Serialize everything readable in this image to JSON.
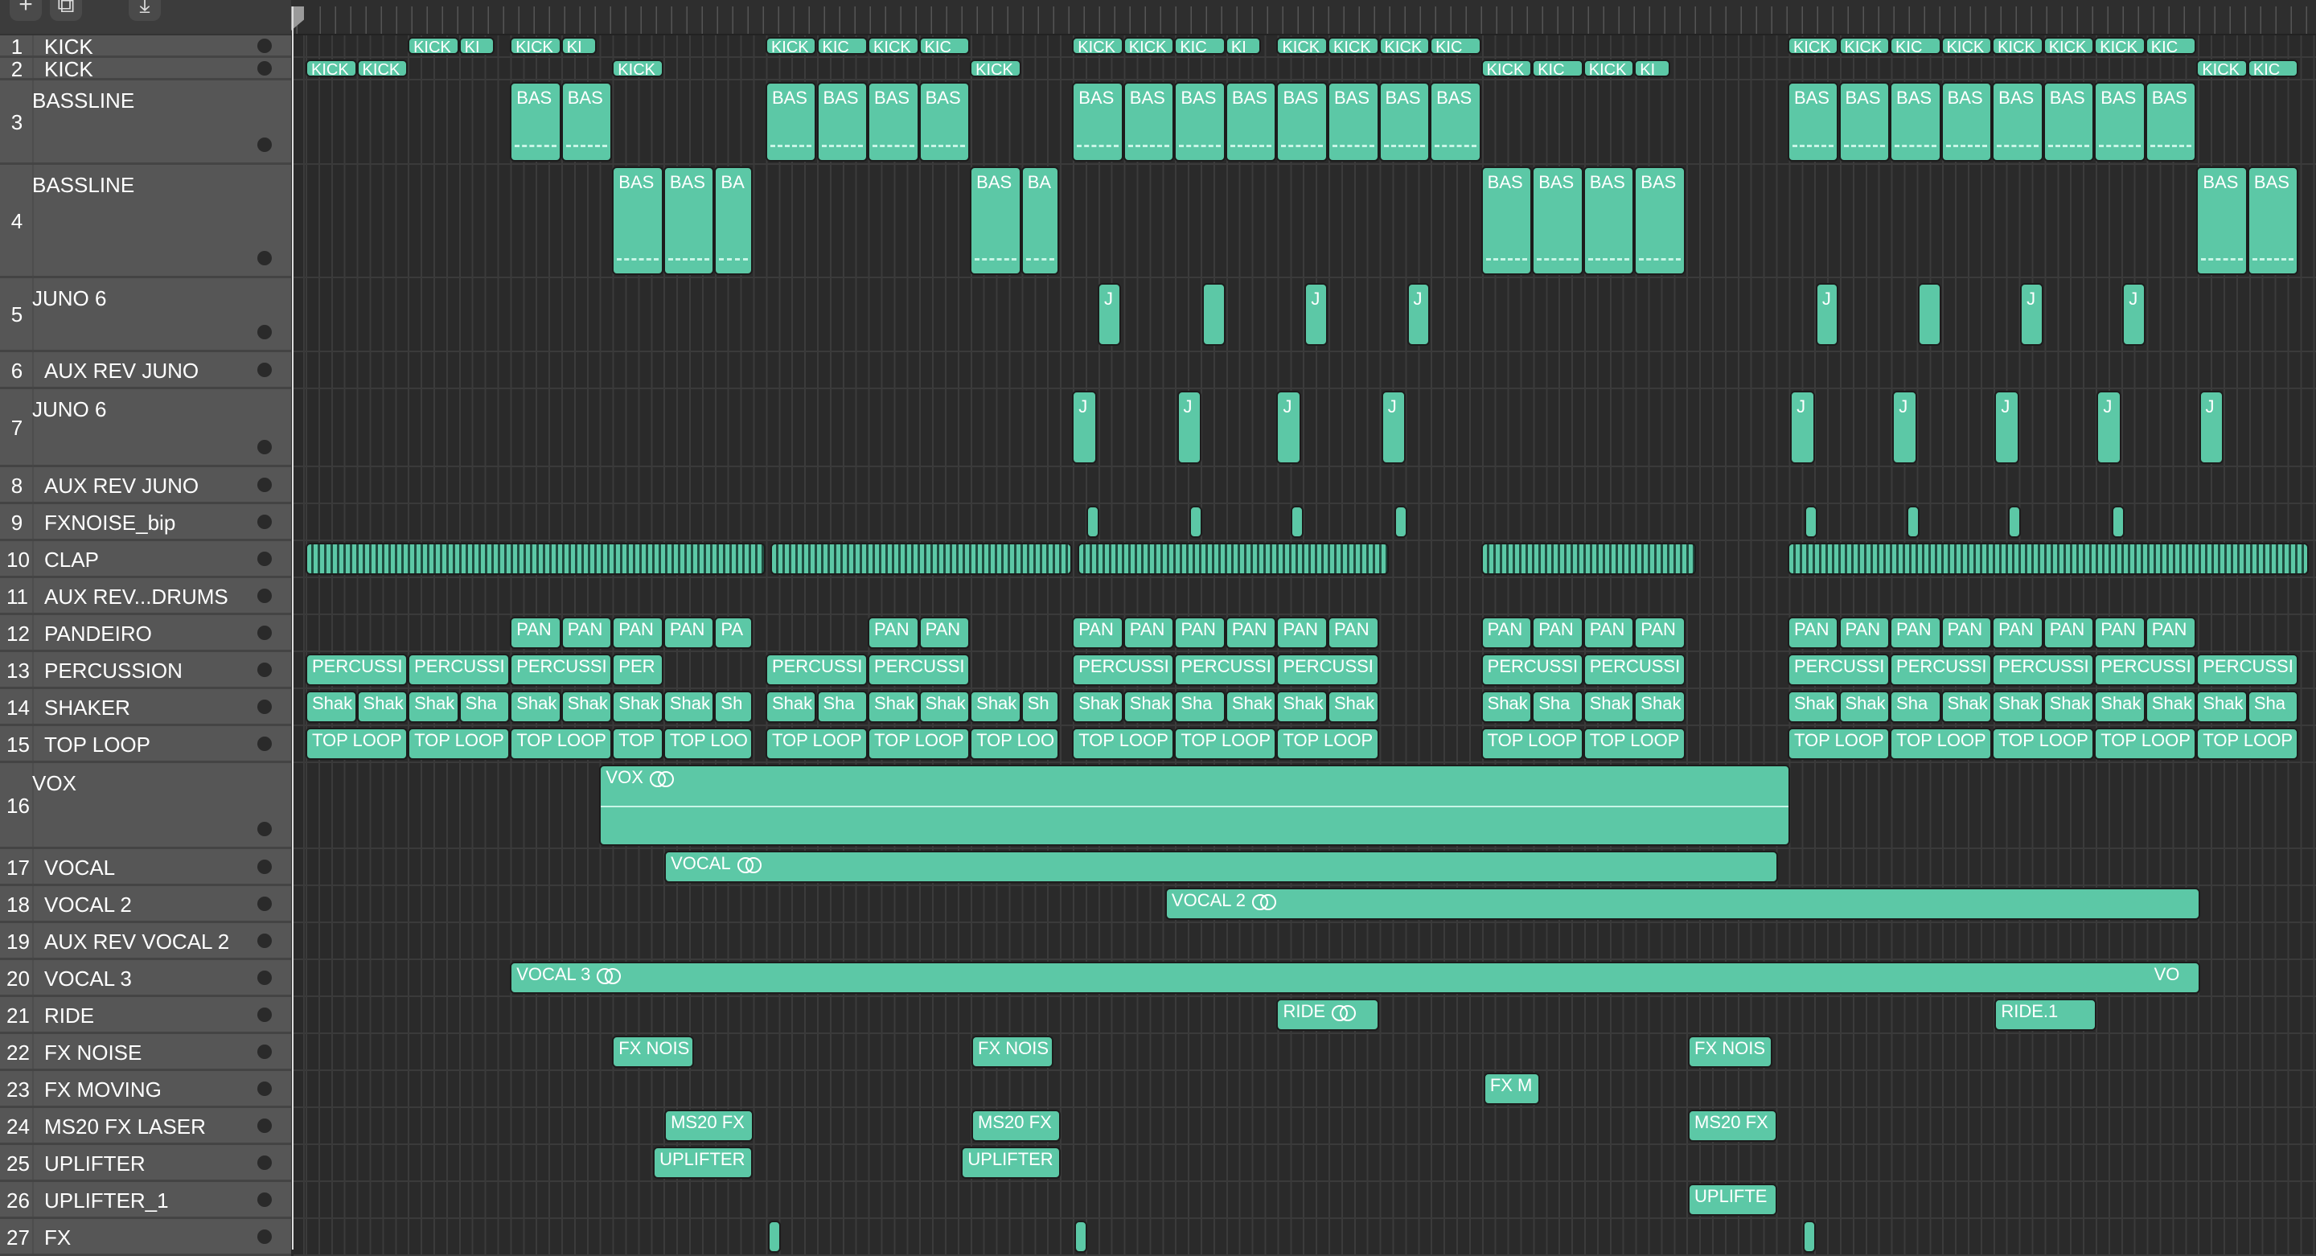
{
  "toolbar": {
    "add_icon": "+",
    "duplicate_icon": "⧉",
    "download_icon": "⤓"
  },
  "colors": {
    "region": "#5cc8a6",
    "header": "#565656",
    "lane": "#2a2a2a"
  },
  "tracks": [
    {
      "num": "1",
      "name": "KICK",
      "regions": [
        {
          "l": "KICK",
          "s": 2,
          "w": 1
        },
        {
          "l": "KI",
          "s": 3,
          "w": 0.7
        },
        {
          "l": "KICK",
          "s": 4,
          "w": 1
        },
        {
          "l": "KI",
          "s": 5,
          "w": 0.7
        },
        {
          "l": "KICK",
          "s": 9,
          "w": 1
        },
        {
          "l": "KIC",
          "s": 10,
          "w": 1
        },
        {
          "l": "KICK",
          "s": 11,
          "w": 1
        },
        {
          "l": "KIC",
          "s": 12,
          "w": 1
        },
        {
          "l": "KICK",
          "s": 15,
          "w": 1
        },
        {
          "l": "KICK",
          "s": 16,
          "w": 1
        },
        {
          "l": "KIC",
          "s": 17,
          "w": 1
        },
        {
          "l": "KI",
          "s": 18,
          "w": 0.7
        },
        {
          "l": "KICK",
          "s": 19,
          "w": 1
        },
        {
          "l": "KICK",
          "s": 20,
          "w": 1
        },
        {
          "l": "KICK",
          "s": 21,
          "w": 1
        },
        {
          "l": "KIC",
          "s": 22,
          "w": 1
        },
        {
          "l": "KICK",
          "s": 29,
          "w": 1
        },
        {
          "l": "KICK",
          "s": 30,
          "w": 1
        },
        {
          "l": "KIC",
          "s": 31,
          "w": 1
        },
        {
          "l": "KICK",
          "s": 32,
          "w": 1
        },
        {
          "l": "KICK",
          "s": 33,
          "w": 1
        },
        {
          "l": "KICK",
          "s": 34,
          "w": 1
        },
        {
          "l": "KICK",
          "s": 35,
          "w": 1
        },
        {
          "l": "KIC",
          "s": 36,
          "w": 1
        }
      ]
    },
    {
      "num": "2",
      "name": "KICK",
      "regions": [
        {
          "l": "KICK",
          "s": 0,
          "w": 1
        },
        {
          "l": "KICK",
          "s": 1,
          "w": 1
        },
        {
          "l": "KICK",
          "s": 6,
          "w": 1
        },
        {
          "l": "KICK",
          "s": 13,
          "w": 1
        },
        {
          "l": "KICK",
          "s": 23,
          "w": 1
        },
        {
          "l": "KIC",
          "s": 24,
          "w": 1
        },
        {
          "l": "KICK",
          "s": 25,
          "w": 1
        },
        {
          "l": "KI",
          "s": 26,
          "w": 0.7
        },
        {
          "l": "KICK",
          "s": 37,
          "w": 1
        },
        {
          "l": "KIC",
          "s": 38,
          "w": 1
        }
      ]
    },
    {
      "num": "3",
      "name": "BASSLINE",
      "regions": [
        {
          "l": "BAS",
          "s": 4,
          "w": 1
        },
        {
          "l": "BAS",
          "s": 5,
          "w": 1
        },
        {
          "l": "BAS",
          "s": 9,
          "w": 1
        },
        {
          "l": "BAS",
          "s": 10,
          "w": 1
        },
        {
          "l": "BAS",
          "s": 11,
          "w": 1
        },
        {
          "l": "BAS",
          "s": 12,
          "w": 1
        },
        {
          "l": "BAS",
          "s": 15,
          "w": 1
        },
        {
          "l": "BAS",
          "s": 16,
          "w": 1
        },
        {
          "l": "BAS",
          "s": 17,
          "w": 1
        },
        {
          "l": "BAS",
          "s": 18,
          "w": 1
        },
        {
          "l": "BAS",
          "s": 19,
          "w": 1
        },
        {
          "l": "BAS",
          "s": 20,
          "w": 1
        },
        {
          "l": "BAS",
          "s": 21,
          "w": 1
        },
        {
          "l": "BAS",
          "s": 22,
          "w": 1
        },
        {
          "l": "BAS",
          "s": 29,
          "w": 1
        },
        {
          "l": "BAS",
          "s": 30,
          "w": 1
        },
        {
          "l": "BAS",
          "s": 31,
          "w": 1
        },
        {
          "l": "BAS",
          "s": 32,
          "w": 1
        },
        {
          "l": "BAS",
          "s": 33,
          "w": 1
        },
        {
          "l": "BAS",
          "s": 34,
          "w": 1
        },
        {
          "l": "BAS",
          "s": 35,
          "w": 1
        },
        {
          "l": "BAS",
          "s": 36,
          "w": 1
        }
      ]
    },
    {
      "num": "4",
      "name": "BASSLINE",
      "regions": [
        {
          "l": "BAS",
          "s": 6,
          "w": 1
        },
        {
          "l": "BAS",
          "s": 7,
          "w": 1
        },
        {
          "l": "BA",
          "s": 8,
          "w": 0.75
        },
        {
          "l": "BAS",
          "s": 13,
          "w": 1
        },
        {
          "l": "BA",
          "s": 14,
          "w": 0.75
        },
        {
          "l": "BAS",
          "s": 23,
          "w": 1
        },
        {
          "l": "BAS",
          "s": 24,
          "w": 1
        },
        {
          "l": "BAS",
          "s": 25,
          "w": 1
        },
        {
          "l": "BAS",
          "s": 26,
          "w": 1
        },
        {
          "l": "BAS",
          "s": 37,
          "w": 1
        },
        {
          "l": "BAS",
          "s": 38,
          "w": 1
        }
      ]
    },
    {
      "num": "5",
      "name": "JUNO 6",
      "regions": [
        {
          "l": "J",
          "s": 15.5,
          "w": 0.45
        },
        {
          "l": "",
          "s": 17.55,
          "w": 0.45
        },
        {
          "l": "J",
          "s": 19.55,
          "w": 0.45
        },
        {
          "l": "J",
          "s": 21.55,
          "w": 0.45
        },
        {
          "l": "J",
          "s": 29.55,
          "w": 0.45
        },
        {
          "l": "",
          "s": 31.55,
          "w": 0.45
        },
        {
          "l": "J",
          "s": 33.55,
          "w": 0.45
        },
        {
          "l": "J",
          "s": 35.55,
          "w": 0.45
        }
      ]
    },
    {
      "num": "6",
      "name": "AUX REV JUNO",
      "regions": []
    },
    {
      "num": "7",
      "name": "JUNO 6",
      "regions": [
        {
          "l": "J",
          "s": 15,
          "w": 0.48
        },
        {
          "l": "J",
          "s": 17.05,
          "w": 0.48
        },
        {
          "l": "J",
          "s": 19,
          "w": 0.48
        },
        {
          "l": "J",
          "s": 21.05,
          "w": 0.48
        },
        {
          "l": "J",
          "s": 29.05,
          "w": 0.48
        },
        {
          "l": "J",
          "s": 31.05,
          "w": 0.48
        },
        {
          "l": "J",
          "s": 33.05,
          "w": 0.48
        },
        {
          "l": "J",
          "s": 35.05,
          "w": 0.48
        },
        {
          "l": "J",
          "s": 37.05,
          "w": 0.48
        }
      ]
    },
    {
      "num": "8",
      "name": "AUX REV JUNO",
      "regions": []
    },
    {
      "num": "9",
      "name": "FXNOISE_bip",
      "regions": [
        {
          "l": "",
          "s": 15.28,
          "w": 0.24
        },
        {
          "l": "",
          "s": 17.3,
          "w": 0.24
        },
        {
          "l": "",
          "s": 19.28,
          "w": 0.24
        },
        {
          "l": "",
          "s": 21.3,
          "w": 0.24
        },
        {
          "l": "",
          "s": 29.33,
          "w": 0.24
        },
        {
          "l": "",
          "s": 31.33,
          "w": 0.24
        },
        {
          "l": "",
          "s": 33.32,
          "w": 0.24
        },
        {
          "l": "",
          "s": 35.34,
          "w": 0.24
        }
      ]
    },
    {
      "num": "10",
      "name": "CLAP",
      "clap": true,
      "regions": [
        {
          "l": "",
          "s": 0,
          "w": 9
        },
        {
          "l": "",
          "s": 9.1,
          "w": 5.9
        },
        {
          "l": "",
          "s": 15.1,
          "w": 6.1
        },
        {
          "l": "",
          "s": 23,
          "w": 4.2
        },
        {
          "l": "",
          "s": 29,
          "w": 10.2
        }
      ]
    },
    {
      "num": "11",
      "name": "AUX REV...DRUMS",
      "regions": []
    },
    {
      "num": "12",
      "name": "PANDEIRO",
      "regions": [
        {
          "l": "PAN",
          "s": 4,
          "w": 1
        },
        {
          "l": "PAN",
          "s": 5,
          "w": 1
        },
        {
          "l": "PAN",
          "s": 6,
          "w": 1
        },
        {
          "l": "PAN",
          "s": 7,
          "w": 1
        },
        {
          "l": "PA",
          "s": 8,
          "w": 0.75
        },
        {
          "l": "PAN",
          "s": 11,
          "w": 1
        },
        {
          "l": "PAN",
          "s": 12,
          "w": 1
        },
        {
          "l": "PAN",
          "s": 15,
          "w": 1
        },
        {
          "l": "PAN",
          "s": 16,
          "w": 1
        },
        {
          "l": "PAN",
          "s": 17,
          "w": 1
        },
        {
          "l": "PAN",
          "s": 18,
          "w": 1
        },
        {
          "l": "PAN",
          "s": 19,
          "w": 1
        },
        {
          "l": "PAN",
          "s": 20,
          "w": 1
        },
        {
          "l": "PAN",
          "s": 23,
          "w": 1
        },
        {
          "l": "PAN",
          "s": 24,
          "w": 1
        },
        {
          "l": "PAN",
          "s": 25,
          "w": 1
        },
        {
          "l": "PAN",
          "s": 26,
          "w": 1
        },
        {
          "l": "PAN",
          "s": 29,
          "w": 1
        },
        {
          "l": "PAN",
          "s": 30,
          "w": 1
        },
        {
          "l": "PAN",
          "s": 31,
          "w": 1
        },
        {
          "l": "PAN",
          "s": 32,
          "w": 1
        },
        {
          "l": "PAN",
          "s": 33,
          "w": 1
        },
        {
          "l": "PAN",
          "s": 34,
          "w": 1
        },
        {
          "l": "PAN",
          "s": 35,
          "w": 1
        },
        {
          "l": "PAN",
          "s": 36,
          "w": 1
        }
      ]
    },
    {
      "num": "13",
      "name": "PERCUSSION",
      "regions": [
        {
          "l": "PERCUSSI",
          "s": 0,
          "w": 2
        },
        {
          "l": "PERCUSSI",
          "s": 2,
          "w": 2
        },
        {
          "l": "PERCUSSI",
          "s": 4,
          "w": 2
        },
        {
          "l": "PER",
          "s": 6,
          "w": 1
        },
        {
          "l": "PERCUSSI",
          "s": 9,
          "w": 2
        },
        {
          "l": "PERCUSSI",
          "s": 11,
          "w": 2
        },
        {
          "l": "PERCUSSI",
          "s": 15,
          "w": 2
        },
        {
          "l": "PERCUSSI",
          "s": 17,
          "w": 2
        },
        {
          "l": "PERCUSSI",
          "s": 19,
          "w": 2
        },
        {
          "l": "PERCUSSI",
          "s": 23,
          "w": 2
        },
        {
          "l": "PERCUSSI",
          "s": 25,
          "w": 2
        },
        {
          "l": "PERCUSSI",
          "s": 29,
          "w": 2
        },
        {
          "l": "PERCUSSI",
          "s": 31,
          "w": 2
        },
        {
          "l": "PERCUSSI",
          "s": 33,
          "w": 2
        },
        {
          "l": "PERCUSSI",
          "s": 35,
          "w": 2
        },
        {
          "l": "PERCUSSI",
          "s": 37,
          "w": 2
        }
      ]
    },
    {
      "num": "14",
      "name": "SHAKER",
      "regions": [
        {
          "l": "Shak",
          "s": 0,
          "w": 1
        },
        {
          "l": "Shak",
          "s": 1,
          "w": 1
        },
        {
          "l": "Shak",
          "s": 2,
          "w": 1
        },
        {
          "l": "Sha",
          "s": 3,
          "w": 1
        },
        {
          "l": "Shak",
          "s": 4,
          "w": 1
        },
        {
          "l": "Shak",
          "s": 5,
          "w": 1
        },
        {
          "l": "Shak",
          "s": 6,
          "w": 1
        },
        {
          "l": "Shak",
          "s": 7,
          "w": 1
        },
        {
          "l": "Sh",
          "s": 8,
          "w": 0.75
        },
        {
          "l": "Shak",
          "s": 9,
          "w": 1
        },
        {
          "l": "Sha",
          "s": 10,
          "w": 1
        },
        {
          "l": "Shak",
          "s": 11,
          "w": 1
        },
        {
          "l": "Shak",
          "s": 12,
          "w": 1
        },
        {
          "l": "Shak",
          "s": 13,
          "w": 1
        },
        {
          "l": "Sh",
          "s": 14,
          "w": 0.75
        },
        {
          "l": "Shak",
          "s": 15,
          "w": 1
        },
        {
          "l": "Shak",
          "s": 16,
          "w": 1
        },
        {
          "l": "Sha",
          "s": 17,
          "w": 1
        },
        {
          "l": "Shak",
          "s": 18,
          "w": 1
        },
        {
          "l": "Shak",
          "s": 19,
          "w": 1
        },
        {
          "l": "Shak",
          "s": 20,
          "w": 1
        },
        {
          "l": "Shak",
          "s": 23,
          "w": 1
        },
        {
          "l": "Sha",
          "s": 24,
          "w": 1
        },
        {
          "l": "Shak",
          "s": 25,
          "w": 1
        },
        {
          "l": "Shak",
          "s": 26,
          "w": 1
        },
        {
          "l": "Shak",
          "s": 29,
          "w": 1
        },
        {
          "l": "Shak",
          "s": 30,
          "w": 1
        },
        {
          "l": "Sha",
          "s": 31,
          "w": 1
        },
        {
          "l": "Shak",
          "s": 32,
          "w": 1
        },
        {
          "l": "Shak",
          "s": 33,
          "w": 1
        },
        {
          "l": "Shak",
          "s": 34,
          "w": 1
        },
        {
          "l": "Shak",
          "s": 35,
          "w": 1
        },
        {
          "l": "Shak",
          "s": 36,
          "w": 1
        },
        {
          "l": "Shak",
          "s": 37,
          "w": 1
        },
        {
          "l": "Sha",
          "s": 38,
          "w": 1
        }
      ]
    },
    {
      "num": "15",
      "name": "TOP LOOP",
      "regions": [
        {
          "l": "TOP LOOP",
          "s": 0,
          "w": 2
        },
        {
          "l": "TOP LOOP",
          "s": 2,
          "w": 2
        },
        {
          "l": "TOP LOOP",
          "s": 4,
          "w": 2
        },
        {
          "l": "TOP",
          "s": 6,
          "w": 1
        },
        {
          "l": "TOP LOO",
          "s": 7,
          "w": 1.75
        },
        {
          "l": "TOP LOOP",
          "s": 9,
          "w": 2
        },
        {
          "l": "TOP LOOP",
          "s": 11,
          "w": 2
        },
        {
          "l": "TOP LOO",
          "s": 13,
          "w": 1.75
        },
        {
          "l": "TOP LOOP",
          "s": 15,
          "w": 2
        },
        {
          "l": "TOP LOOP",
          "s": 17,
          "w": 2
        },
        {
          "l": "TOP LOOP",
          "s": 19,
          "w": 2
        },
        {
          "l": "TOP LOOP",
          "s": 23,
          "w": 2
        },
        {
          "l": "TOP LOOP",
          "s": 25,
          "w": 2
        },
        {
          "l": "TOP LOOP",
          "s": 29,
          "w": 2
        },
        {
          "l": "TOP LOOP",
          "s": 31,
          "w": 2
        },
        {
          "l": "TOP LOOP",
          "s": 33,
          "w": 2
        },
        {
          "l": "TOP LOOP",
          "s": 35,
          "w": 2
        },
        {
          "l": "TOP LOOP",
          "s": 37,
          "w": 2
        }
      ]
    },
    {
      "num": "16",
      "name": "VOX",
      "regions": [
        {
          "l": "VOX",
          "s": 5.75,
          "w": 23.3,
          "loop": true,
          "wave": true
        }
      ]
    },
    {
      "num": "17",
      "name": "VOCAL",
      "regions": [
        {
          "l": "VOCAL",
          "s": 7.02,
          "w": 21.8,
          "loop": true
        }
      ]
    },
    {
      "num": "18",
      "name": "VOCAL 2",
      "regions": [
        {
          "l": "VOCAL 2",
          "s": 16.82,
          "w": 20.26,
          "loop": true
        }
      ]
    },
    {
      "num": "19",
      "name": "AUX REV VOCAL 2",
      "regions": []
    },
    {
      "num": "20",
      "name": "VOCAL 3",
      "regions": [
        {
          "l": "VOCAL 3",
          "s": 4,
          "w": 33.08,
          "loop": true,
          "end": "VO"
        }
      ]
    },
    {
      "num": "21",
      "name": "RIDE",
      "regions": [
        {
          "l": "RIDE",
          "s": 19,
          "w": 2,
          "loop": true
        },
        {
          "l": "RIDE.1",
          "s": 33.05,
          "w": 2
        }
      ]
    },
    {
      "num": "22",
      "name": "FX NOISE",
      "regions": [
        {
          "l": "FX NOIS",
          "s": 6,
          "w": 1.6
        },
        {
          "l": "FX NOIS",
          "s": 13.03,
          "w": 1.6
        },
        {
          "l": "FX NOIS",
          "s": 27.05,
          "w": 1.65
        }
      ]
    },
    {
      "num": "23",
      "name": "FX MOVING",
      "regions": [
        {
          "l": "FX M",
          "s": 23.05,
          "w": 1.1
        }
      ]
    },
    {
      "num": "24",
      "name": "MS20 FX LASER",
      "regions": [
        {
          "l": "MS20 FX",
          "s": 7.02,
          "w": 1.75
        },
        {
          "l": "MS20 FX",
          "s": 13.03,
          "w": 1.75
        },
        {
          "l": "MS20 FX",
          "s": 27.05,
          "w": 1.75
        }
      ]
    },
    {
      "num": "25",
      "name": "UPLIFTER",
      "regions": [
        {
          "l": "UPLIFTER",
          "s": 6.8,
          "w": 1.95
        },
        {
          "l": "UPLIFTER",
          "s": 12.83,
          "w": 1.95
        }
      ]
    },
    {
      "num": "26",
      "name": "UPLIFTER_1",
      "regions": [
        {
          "l": "UPLIFTE",
          "s": 27.05,
          "w": 1.75
        }
      ]
    },
    {
      "num": "27",
      "name": "FX",
      "regions": [
        {
          "l": "",
          "s": 9.05,
          "w": 0.25
        },
        {
          "l": "",
          "s": 15.05,
          "w": 0.25
        },
        {
          "l": "",
          "s": 29.3,
          "w": 0.25
        }
      ]
    }
  ]
}
